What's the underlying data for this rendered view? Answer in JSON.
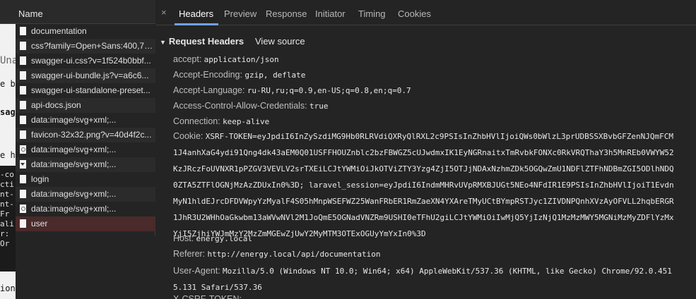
{
  "list": {
    "column_name": "Name",
    "rows": [
      {
        "name": "documentation",
        "icon": "file-icon"
      },
      {
        "name": "css?family=Open+Sans:400,70...",
        "icon": "file-icon"
      },
      {
        "name": "swagger-ui.css?v=1f524b0bbf...",
        "icon": "file-icon"
      },
      {
        "name": "swagger-ui-bundle.js?v=a6c6...",
        "icon": "file-icon"
      },
      {
        "name": "swagger-ui-standalone-preset...",
        "icon": "file-icon"
      },
      {
        "name": "api-docs.json",
        "icon": "file-icon"
      },
      {
        "name": "data:image/svg+xml;...",
        "icon": "file-icon"
      },
      {
        "name": "favicon-32x32.png?v=40d4f2c...",
        "icon": "file-icon"
      },
      {
        "name": "data:image/svg+xml;...",
        "icon": "broken-image-icon"
      },
      {
        "name": "data:image/svg+xml;...",
        "icon": "arrow-image-icon"
      },
      {
        "name": "login",
        "icon": "file-icon"
      },
      {
        "name": "data:image/svg+xml;...",
        "icon": "file-icon"
      },
      {
        "name": "data:image/svg+xml;...",
        "icon": "broken-image-icon"
      },
      {
        "name": "user",
        "icon": "file-icon"
      }
    ]
  },
  "background_fragments": {
    "light": [
      "Una",
      "e b",
      "sage",
      "e he"
    ],
    "dark": [
      "-co",
      "cti",
      "nt-",
      "nt-",
      " Fr",
      "ali",
      "r:",
      " Or"
    ],
    "bottom": "ion"
  },
  "tabs": {
    "close": "×",
    "items": [
      "Headers",
      "Preview",
      "Response",
      "Initiator",
      "Timing",
      "Cookies"
    ],
    "active": "Headers"
  },
  "section": {
    "title": "Request Headers",
    "view_source": "View source"
  },
  "headers": [
    {
      "key": "accept:",
      "value": "application/json"
    },
    {
      "key": "Accept-Encoding:",
      "value": "gzip, deflate"
    },
    {
      "key": "Accept-Language:",
      "value": "ru-RU,ru;q=0.9,en-US;q=0.8,en;q=0.7"
    },
    {
      "key": "Access-Control-Allow-Credentials:",
      "value": "true"
    },
    {
      "key": "Connection:",
      "value": "keep-alive"
    },
    {
      "key": "Cookie:",
      "value": "XSRF-TOKEN=eyJpdiI6InZySzdiMG9Hb0RLRVdiQXRyQlRXL2c9PSIsInZhbHVlIjoiQWs0bWlzL3prUDBSSXBvbGFZenNJQmFCM1J4anhXaG4ydi91Qng4dk43aEM0Q01USFFHOUZnblc2bzFBWGZ5cUJwdmxIK1EyNGRnaitxTmRvbkFONXc0RkVRQThaY3h5MnREb0VWYW52KzJRczFoUVNXR1pPZGV3VEVLV2srTXEiLCJtYWMiOiJkOTViZTY3Yzg4ZjI5OTJjNDAxNzhmZDk5OGQwZmU1NDFlZTFhNDBmZGI5ODlhNDQ0ZTA5ZTFlOGNjMzAzZDUxIn0%3D; laravel_session=eyJpdiI6IndmMHRvUVpRMXBJUGt5NEo4NFdIR1E9PSIsInZhbHVlIjoiT1EvdnMyN1hldEJrcDFDVWpyYzMyalF4S05hMnpWSEFWZ25WanFRbER1RmZaeXN4YXAreTMyUCtBYmpRSTJyc1ZIVDNPQnhXVzAyOFVLL2hqbERGR1JhR3U2WHhOaGkwbm13aWVwNVl2M1JoQmE5OGNadVNZRm9USHI0eTFhU2giLCJtYWMiOiIwMjQ5YjIzNjQ1MzMzMWY5MGNiMzMyZDFlYzMxYjI5ZjhiYWJmMzY2MzZmMGEwZjUwY2MyMTM3OTExOGUyYmYxIn0%3D"
    },
    {
      "key": "Host:",
      "value": "energy.local"
    },
    {
      "key": "Referer:",
      "value": "http://energy.local/api/documentation"
    },
    {
      "key": "User-Agent:",
      "value": "Mozilla/5.0 (Windows NT 10.0; Win64; x64) AppleWebKit/537.36 (KHTML, like Gecko) Chrome/92.0.4515.131 Safari/537.36"
    },
    {
      "key": "X-CSRF-TOKEN:",
      "value": ""
    }
  ]
}
